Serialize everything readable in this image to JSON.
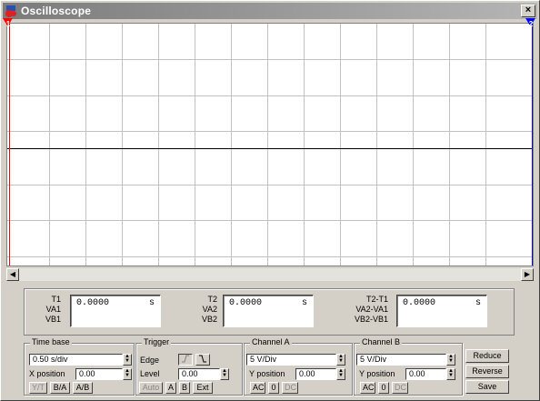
{
  "window": {
    "title": "Oscilloscope",
    "close_label": "×"
  },
  "cursors": {
    "a_label": "1",
    "b_label": "2"
  },
  "colors": {
    "cursor_a": "#ff0000",
    "cursor_b": "#0000ff",
    "grid": "#c0c0c0",
    "trace": "#000000"
  },
  "scroll": {
    "left_arrow": "◀",
    "right_arrow": "▶"
  },
  "readouts": [
    {
      "labels": [
        "T1",
        "VA1",
        "VB1"
      ],
      "time": "0.0000",
      "unit": "s"
    },
    {
      "labels": [
        "T2",
        "VA2",
        "VB2"
      ],
      "time": "0.0000",
      "unit": "s"
    },
    {
      "labels": [
        "T2-T1",
        "VA2-VA1",
        "VB2-VB1"
      ],
      "time": "0.0000",
      "unit": "s"
    }
  ],
  "timebase": {
    "label": "Time base",
    "value": "0.50 s/div",
    "xpos_label": "X position",
    "xpos_value": "0.00",
    "modes": [
      "Y/T",
      "B/A",
      "A/B"
    ]
  },
  "trigger": {
    "label": "Trigger",
    "edge_label": "Edge",
    "rising_icon": "rising-edge-icon",
    "falling_icon": "falling-edge-icon",
    "level_label": "Level",
    "level_value": "0.00",
    "sources": [
      "Auto",
      "A",
      "B",
      "Ext"
    ]
  },
  "channel_a": {
    "label": "Channel A",
    "value": "5 V/Div",
    "ypos_label": "Y position",
    "ypos_value": "0.00",
    "coupling": [
      "AC",
      "0",
      "DC"
    ]
  },
  "channel_b": {
    "label": "Channel B",
    "value": "5 V/Div",
    "ypos_label": "Y position",
    "ypos_value": "0.00",
    "coupling": [
      "AC",
      "0",
      "DC"
    ]
  },
  "actions": {
    "reduce": "Reduce",
    "reverse": "Reverse",
    "save": "Save"
  }
}
